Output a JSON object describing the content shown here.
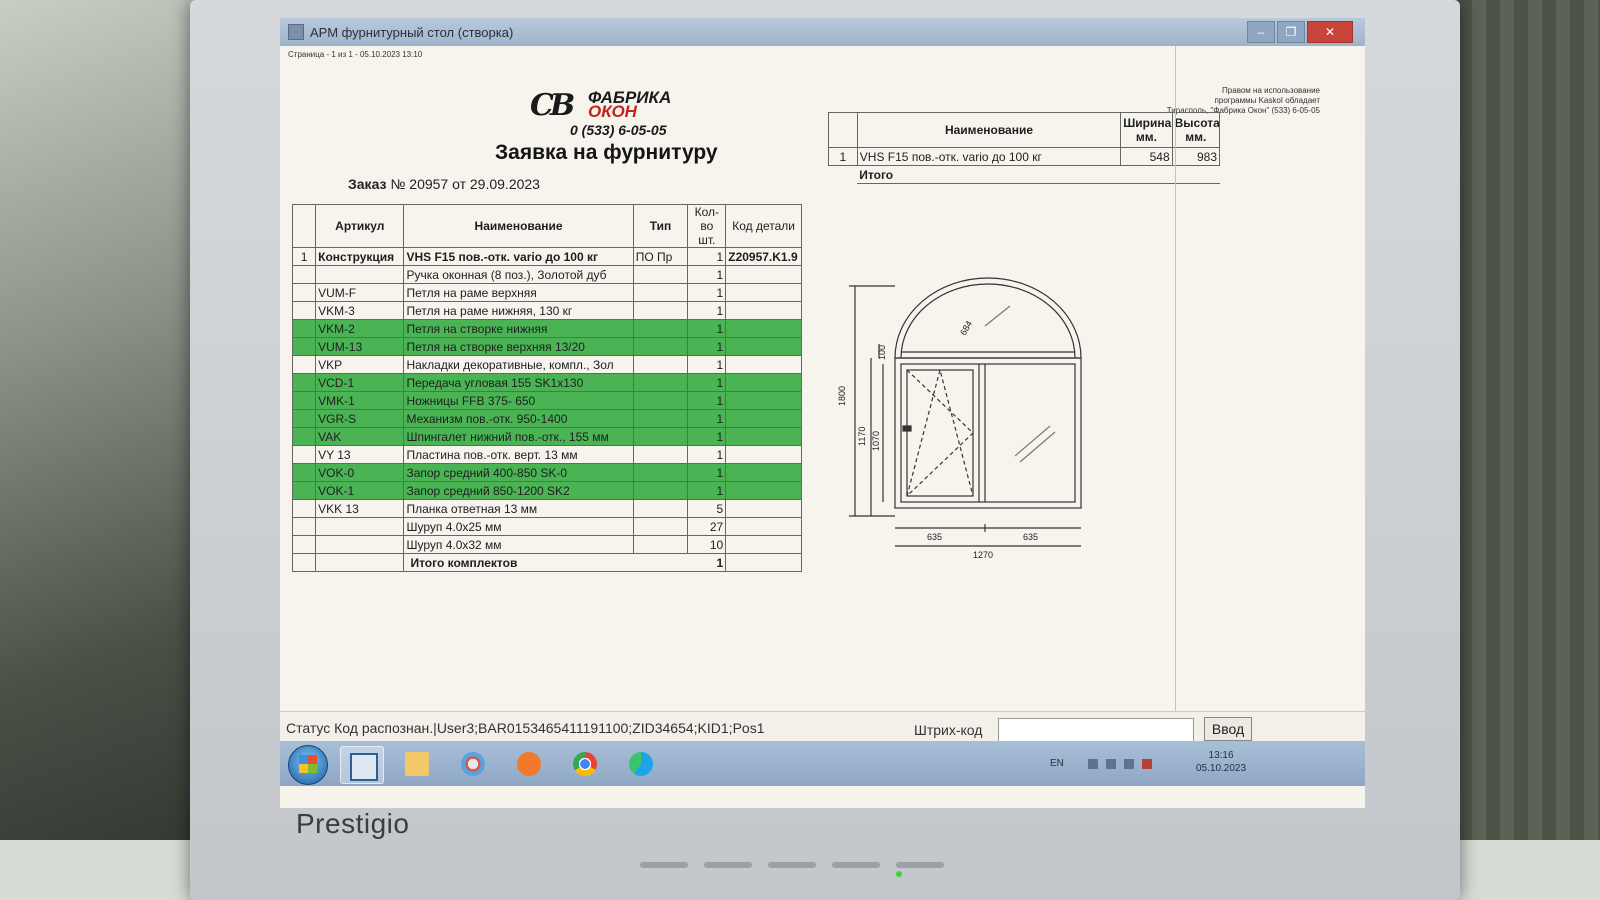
{
  "window": {
    "title": "АРМ фурнитурный стол (створка)"
  },
  "document": {
    "page_info": "Страница - 1 из 1 - 05.10.2023 13:10",
    "logo": {
      "mark": "СВ",
      "line1": "ФАБРИКА",
      "line2": "ОКОН",
      "phone": "0 (533) 6-05-05"
    },
    "title": "Заявка на фурнитуру",
    "order_label": "Заказ",
    "order_number": "№ 20957",
    "order_date": "от 29.09.2023",
    "legal_note": [
      "Правом на использование",
      "программы KaskoI обладает",
      "Тирасполь, \"Фабрика Окон\" (533) 6-05-05"
    ],
    "parts_table": {
      "headers": [
        "",
        "Артикул",
        "Наименование",
        "Тип",
        "Кол-во шт.",
        "Код детали"
      ],
      "rows": [
        {
          "idx": "1",
          "article": "Конструкция",
          "name": "VHS F15 пов.-отк. vario до 100 кг",
          "type": "ПО Пр",
          "qty": "1",
          "code": "Z20957.K1.9",
          "highlight": false,
          "bold": true
        },
        {
          "idx": "",
          "article": "",
          "name": "Ручка оконная (8 поз.), Золотой дуб",
          "type": "",
          "qty": "1",
          "code": "",
          "highlight": false,
          "bold": false
        },
        {
          "idx": "",
          "article": "VUM-F",
          "name": "Петля на раме верхняя",
          "type": "",
          "qty": "1",
          "code": "",
          "highlight": false,
          "bold": false
        },
        {
          "idx": "",
          "article": "VKM-3",
          "name": "Петля на раме нижняя, 130 кг",
          "type": "",
          "qty": "1",
          "code": "",
          "highlight": false,
          "bold": false
        },
        {
          "idx": "",
          "article": "VKM-2",
          "name": "Петля на створке нижняя",
          "type": "",
          "qty": "1",
          "code": "",
          "highlight": true,
          "bold": false
        },
        {
          "idx": "",
          "article": "VUM-13",
          "name": "Петля на створке верхняя 13/20",
          "type": "",
          "qty": "1",
          "code": "",
          "highlight": true,
          "bold": false
        },
        {
          "idx": "",
          "article": "VKP",
          "name": "Накладки декоративные, компл., Зол",
          "type": "",
          "qty": "1",
          "code": "",
          "highlight": false,
          "bold": false
        },
        {
          "idx": "",
          "article": "VCD-1",
          "name": "Передача угловая 155 SK1x130",
          "type": "",
          "qty": "1",
          "code": "",
          "highlight": true,
          "bold": false
        },
        {
          "idx": "",
          "article": "VMK-1",
          "name": "Ножницы FFB 375- 650",
          "type": "",
          "qty": "1",
          "code": "",
          "highlight": true,
          "bold": false
        },
        {
          "idx": "",
          "article": "VGR-S",
          "name": "Механизм пов.-отк. 950-1400",
          "type": "",
          "qty": "1",
          "code": "",
          "highlight": true,
          "bold": false
        },
        {
          "idx": "",
          "article": "VAK",
          "name": "Шпингалет нижний пов.-отк., 155 мм",
          "type": "",
          "qty": "1",
          "code": "",
          "highlight": true,
          "bold": false
        },
        {
          "idx": "",
          "article": "VY 13",
          "name": "Пластина пов.-отк. верт. 13 мм",
          "type": "",
          "qty": "1",
          "code": "",
          "highlight": false,
          "bold": false
        },
        {
          "idx": "",
          "article": "VOK-0",
          "name": "Запор средний 400-850 SK-0",
          "type": "",
          "qty": "1",
          "code": "",
          "highlight": true,
          "bold": false
        },
        {
          "idx": "",
          "article": "VOK-1",
          "name": "Запор средний  850-1200 SK2",
          "type": "",
          "qty": "1",
          "code": "",
          "highlight": true,
          "bold": false
        },
        {
          "idx": "",
          "article": "VKK 13",
          "name": "Планка ответная 13 мм",
          "type": "",
          "qty": "5",
          "code": "",
          "highlight": false,
          "bold": false
        },
        {
          "idx": "",
          "article": "",
          "name": "Шуруп 4.0x25 мм",
          "type": "",
          "qty": "27",
          "code": "",
          "highlight": false,
          "bold": false
        },
        {
          "idx": "",
          "article": "",
          "name": "Шуруп 4.0x32 мм",
          "type": "",
          "qty": "10",
          "code": "",
          "highlight": false,
          "bold": false
        }
      ],
      "total_label": "Итого комплектов",
      "total_value": "1"
    },
    "right_table": {
      "headers": [
        "",
        "Наименование",
        "Ширина мм.",
        "Высота мм."
      ],
      "rows": [
        {
          "idx": "1",
          "name": "VHS F15 пов.-отк. vario до 100 кг",
          "width": "548",
          "height": "983"
        }
      ],
      "total_label": "Итого"
    },
    "drawing": {
      "dims": {
        "arc": "684",
        "total_height": "1800",
        "h_1170": "1170",
        "h_1070": "1070",
        "h_100": "100",
        "w_left": "635",
        "w_right": "635",
        "w_total": "1270"
      }
    }
  },
  "status_bar": {
    "status_text": "Статус Код распознан.|User3;BAR0153465411191100;ZID34654;KID1;Pos1",
    "barcode_label": "Штрих-код",
    "barcode_value": "",
    "enter_label": "Ввод"
  },
  "taskbar": {
    "items": [
      "start-orb",
      "app-arm",
      "explorer",
      "paint",
      "media-player",
      "chrome",
      "edge"
    ],
    "lang": "EN",
    "time": "13:16",
    "date": "05.10.2023"
  },
  "monitor": {
    "brand": "Prestigio"
  },
  "colors": {
    "highlight": "#4ab455",
    "titlebar": "#9fb4cb",
    "close": "#c9453b"
  }
}
